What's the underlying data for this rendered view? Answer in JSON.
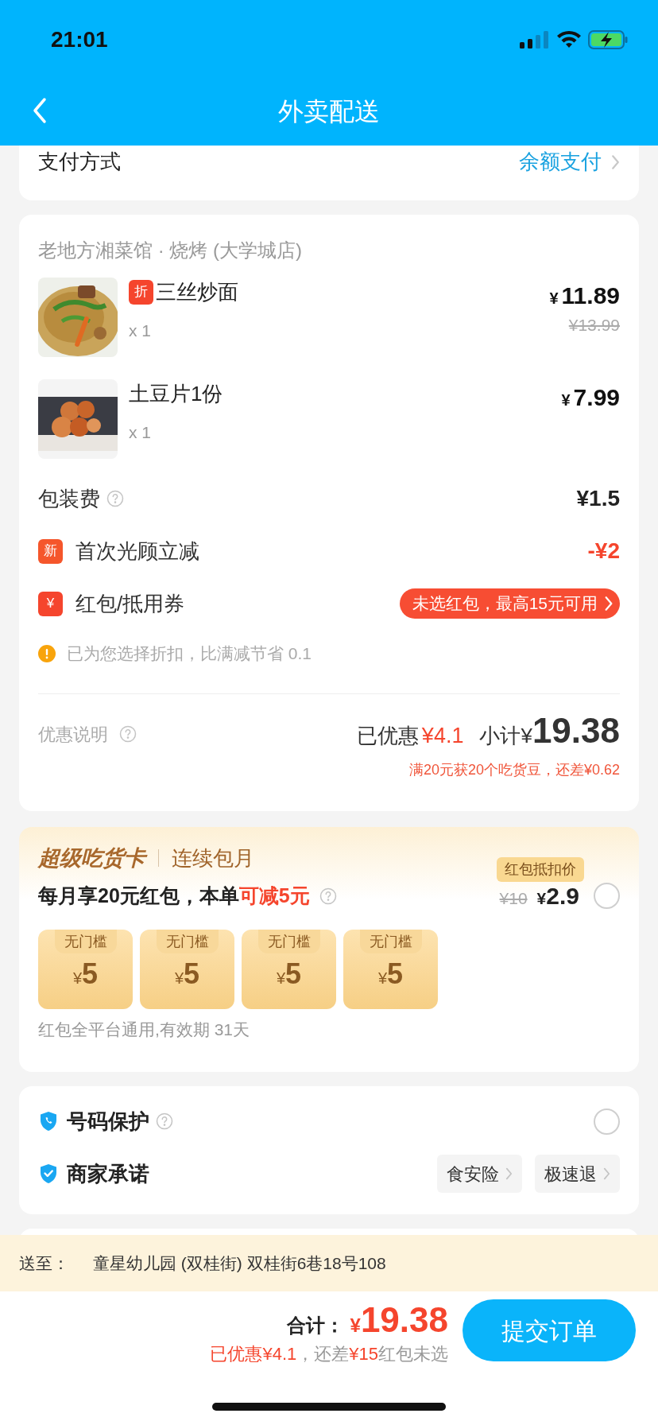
{
  "status_bar": {
    "time": "21:01"
  },
  "header": {
    "title": "外卖配送"
  },
  "payment": {
    "label": "支付方式",
    "value": "余额支付"
  },
  "order": {
    "shop": "老地方湘菜馆 · 烧烤 (大学城店)",
    "items": [
      {
        "kind": "noodles",
        "badge": "折",
        "name": "三丝炒面",
        "qty": "x 1",
        "currency": "¥",
        "price": "11.89",
        "original_price": "¥13.99"
      },
      {
        "kind": "chips",
        "name": "土豆片1份",
        "qty": "x 1",
        "currency": "¥",
        "price": "7.99"
      }
    ],
    "fees": [
      {
        "kind": "fee",
        "label": "包装费",
        "value": "¥1.5"
      },
      {
        "kind": "discount",
        "badge": "新",
        "label": "首次光顾立减",
        "value": "-¥2"
      },
      {
        "kind": "coupon",
        "badge": "¥",
        "label": "红包/抵用券",
        "value": "未选红包，最高15元可用"
      }
    ],
    "notice": "已为您选择折扣，比满减节省 0.1",
    "summary": {
      "label": "优惠说明",
      "saved_label": "已优惠",
      "saved": "¥4.1",
      "subtotal_label": "小计",
      "currency": "¥",
      "subtotal": "19.38",
      "note": "满20元获20个吃货豆，还差¥0.62"
    }
  },
  "membership": {
    "brand": "超级吃货卡",
    "plan": "连续包月",
    "tooltip": "红包抵扣价",
    "offer": [
      {
        "text": "每月享20元红包，本单",
        "highlight": false
      },
      {
        "text": "可减5元",
        "highlight": true
      }
    ],
    "old_price": "¥10",
    "currency": "¥",
    "price": "2.9",
    "selected": false,
    "vouchers": [
      {
        "label": "无门槛",
        "currency": "¥",
        "amount": "5"
      },
      {
        "label": "无门槛",
        "currency": "¥",
        "amount": "5"
      },
      {
        "label": "无门槛",
        "currency": "¥",
        "amount": "5"
      },
      {
        "label": "无门槛",
        "currency": "¥",
        "amount": "5"
      }
    ],
    "validity": "红包全平台通用,有效期 31天"
  },
  "services": [
    {
      "kind": "toggle",
      "label": "号码保护",
      "checked": false
    },
    {
      "kind": "tags",
      "label": "商家承诺",
      "tags": [
        "食安险",
        "极速退"
      ]
    }
  ],
  "address": {
    "label": "送至：",
    "text": "童星幼儿园 (双桂街) 双桂街6巷18号108"
  },
  "footer": {
    "total_label": "合计：",
    "currency": "¥",
    "total": "19.38",
    "note": [
      {
        "text": "已优惠¥4.1",
        "highlight": true
      },
      {
        "text": "，还差",
        "highlight": false
      },
      {
        "text": "¥15",
        "highlight": true
      },
      {
        "text": "红包未选",
        "highlight": false
      }
    ],
    "submit": "提交订单"
  }
}
